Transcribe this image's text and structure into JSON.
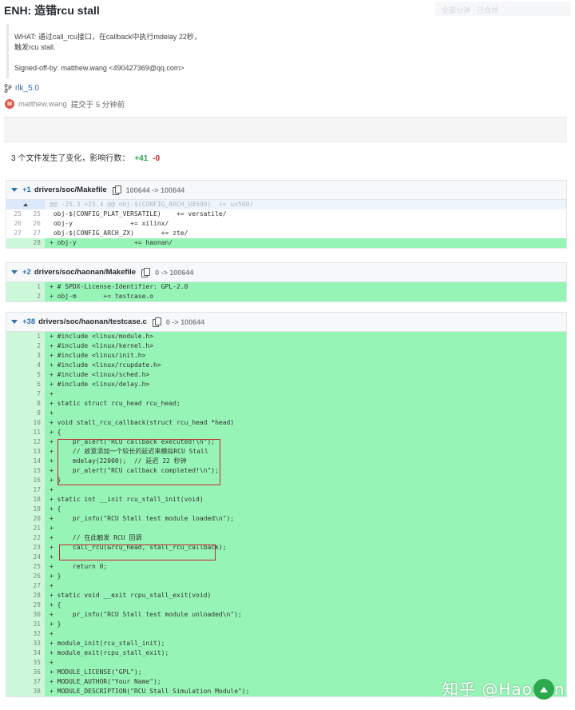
{
  "commit": {
    "title": "ENH: 造错rcu stall",
    "ghost_tab": "全部分钟 · 已合并",
    "message_line1": "WHAT: 通过call_rcu接口，在callback中执行mdelay 22秒，",
    "message_line2": "触发rcu stall.",
    "signed_off": "Signed-off-by: matthew.wang <490427369@qq.com>",
    "branch": "rlk_5.0",
    "avatar_letter": "M",
    "author": "matthew.wang",
    "time_text": "提交于 5 分钟前"
  },
  "stats": {
    "summary": "3 个文件发生了变化，影响行数：",
    "additions": "+41",
    "deletions": "-0"
  },
  "files": [
    {
      "add_count": "+1",
      "path": "drivers/soc/Makefile",
      "mode": "100644 -> 100644",
      "hunk": "@@ -25,3 +25,4 @@ obj-$(CONFIG_ARCH_U8500)  += ux500/",
      "lines": [
        {
          "old": "25",
          "new": "25",
          "type": "ctx",
          "text": " obj-$(CONFIG_PLAT_VERSATILE)    += versatile/"
        },
        {
          "old": "26",
          "new": "26",
          "type": "ctx",
          "text": " obj-y               += xilinx/"
        },
        {
          "old": "27",
          "new": "27",
          "type": "ctx",
          "text": " obj-$(CONFIG_ARCH_ZX)       += zte/"
        },
        {
          "old": "",
          "new": "28",
          "type": "add",
          "text": "+ obj-y               += haonan/"
        }
      ]
    },
    {
      "add_count": "+2",
      "path": "drivers/soc/haonan/Makefile",
      "mode": "0 -> 100644",
      "lines": [
        {
          "old": "",
          "new": "1",
          "type": "add",
          "text": "+ # SPDX-License-Identifier: GPL-2.0"
        },
        {
          "old": "",
          "new": "2",
          "type": "add",
          "text": "+ obj-m       += testcase.o"
        }
      ]
    },
    {
      "add_count": "+38",
      "path": "drivers/soc/haonan/testcase.c",
      "mode": "0 -> 100644",
      "lines": [
        {
          "old": "",
          "new": "1",
          "type": "add",
          "text": "+ #include <linux/module.h>"
        },
        {
          "old": "",
          "new": "2",
          "type": "add",
          "text": "+ #include <linux/kernel.h>"
        },
        {
          "old": "",
          "new": "3",
          "type": "add",
          "text": "+ #include <linux/init.h>"
        },
        {
          "old": "",
          "new": "4",
          "type": "add",
          "text": "+ #include <linux/rcupdate.h>"
        },
        {
          "old": "",
          "new": "5",
          "type": "add",
          "text": "+ #include <linux/sched.h>"
        },
        {
          "old": "",
          "new": "6",
          "type": "add",
          "text": "+ #include <linux/delay.h>"
        },
        {
          "old": "",
          "new": "7",
          "type": "add",
          "text": "+"
        },
        {
          "old": "",
          "new": "8",
          "type": "add",
          "text": "+ static struct rcu_head rcu_head;"
        },
        {
          "old": "",
          "new": "9",
          "type": "add",
          "text": "+"
        },
        {
          "old": "",
          "new": "10",
          "type": "add",
          "text": "+ void stall_rcu_callback(struct rcu_head *head)"
        },
        {
          "old": "",
          "new": "11",
          "type": "add",
          "text": "+ {"
        },
        {
          "old": "",
          "new": "12",
          "type": "add",
          "text": "+     pr_alert(\"RCU callback executed!\\n\");"
        },
        {
          "old": "",
          "new": "13",
          "type": "add",
          "text": "+     // 故意添加一个较长的延迟来模拟RCU Stall"
        },
        {
          "old": "",
          "new": "14",
          "type": "add",
          "text": "+     mdelay(22000);  // 延迟 22 秒钟"
        },
        {
          "old": "",
          "new": "15",
          "type": "add",
          "text": "+     pr_alert(\"RCU callback completed!\\n\");"
        },
        {
          "old": "",
          "new": "16",
          "type": "add",
          "text": "+ }"
        },
        {
          "old": "",
          "new": "17",
          "type": "add",
          "text": "+"
        },
        {
          "old": "",
          "new": "18",
          "type": "add",
          "text": "+ static int __init rcu_stall_init(void)"
        },
        {
          "old": "",
          "new": "19",
          "type": "add",
          "text": "+ {"
        },
        {
          "old": "",
          "new": "20",
          "type": "add",
          "text": "+     pr_info(\"RCU Stall test module loaded\\n\");"
        },
        {
          "old": "",
          "new": "21",
          "type": "add",
          "text": "+"
        },
        {
          "old": "",
          "new": "22",
          "type": "add",
          "text": "+     // 在此触发 RCU 回调"
        },
        {
          "old": "",
          "new": "23",
          "type": "add",
          "text": "+     call_rcu(&rcu_head, stall_rcu_callback);"
        },
        {
          "old": "",
          "new": "24",
          "type": "add",
          "text": "+"
        },
        {
          "old": "",
          "new": "25",
          "type": "add",
          "text": "+     return 0;"
        },
        {
          "old": "",
          "new": "26",
          "type": "add",
          "text": "+ }"
        },
        {
          "old": "",
          "new": "27",
          "type": "add",
          "text": "+"
        },
        {
          "old": "",
          "new": "28",
          "type": "add",
          "text": "+ static void __exit rcpu_stall_exit(void)"
        },
        {
          "old": "",
          "new": "29",
          "type": "add",
          "text": "+ {"
        },
        {
          "old": "",
          "new": "30",
          "type": "add",
          "text": "+     pr_info(\"RCU Stall test module unloaded\\n\");"
        },
        {
          "old": "",
          "new": "31",
          "type": "add",
          "text": "+ }"
        },
        {
          "old": "",
          "new": "32",
          "type": "add",
          "text": "+"
        },
        {
          "old": "",
          "new": "33",
          "type": "add",
          "text": "+ module_init(rcu_stall_init);"
        },
        {
          "old": "",
          "new": "34",
          "type": "add",
          "text": "+ module_exit(rcpu_stall_exit);"
        },
        {
          "old": "",
          "new": "35",
          "type": "add",
          "text": "+"
        },
        {
          "old": "",
          "new": "36",
          "type": "add",
          "text": "+ MODULE_LICENSE(\"GPL\");"
        },
        {
          "old": "",
          "new": "37",
          "type": "add",
          "text": "+ MODULE_AUTHOR(\"Your Name\");"
        },
        {
          "old": "",
          "new": "38",
          "type": "add",
          "text": "+ MODULE_DESCRIPTION(\"RCU Stall Simulation Module\");"
        }
      ]
    }
  ],
  "watermark": "知乎 @Haonan",
  "icons": {
    "branch": "git-branch-icon",
    "copy": "copy-icon",
    "collapse": "caret-down-icon",
    "expand": "expand-up-icon",
    "scroll_top": "scroll-to-top-icon"
  },
  "colors": {
    "added_line": "#96f5b6",
    "added_gutter": "#cdf7d9",
    "hunk": "#eef4fc",
    "link": "#2f6fb2",
    "highlight_box": "#c62828"
  }
}
